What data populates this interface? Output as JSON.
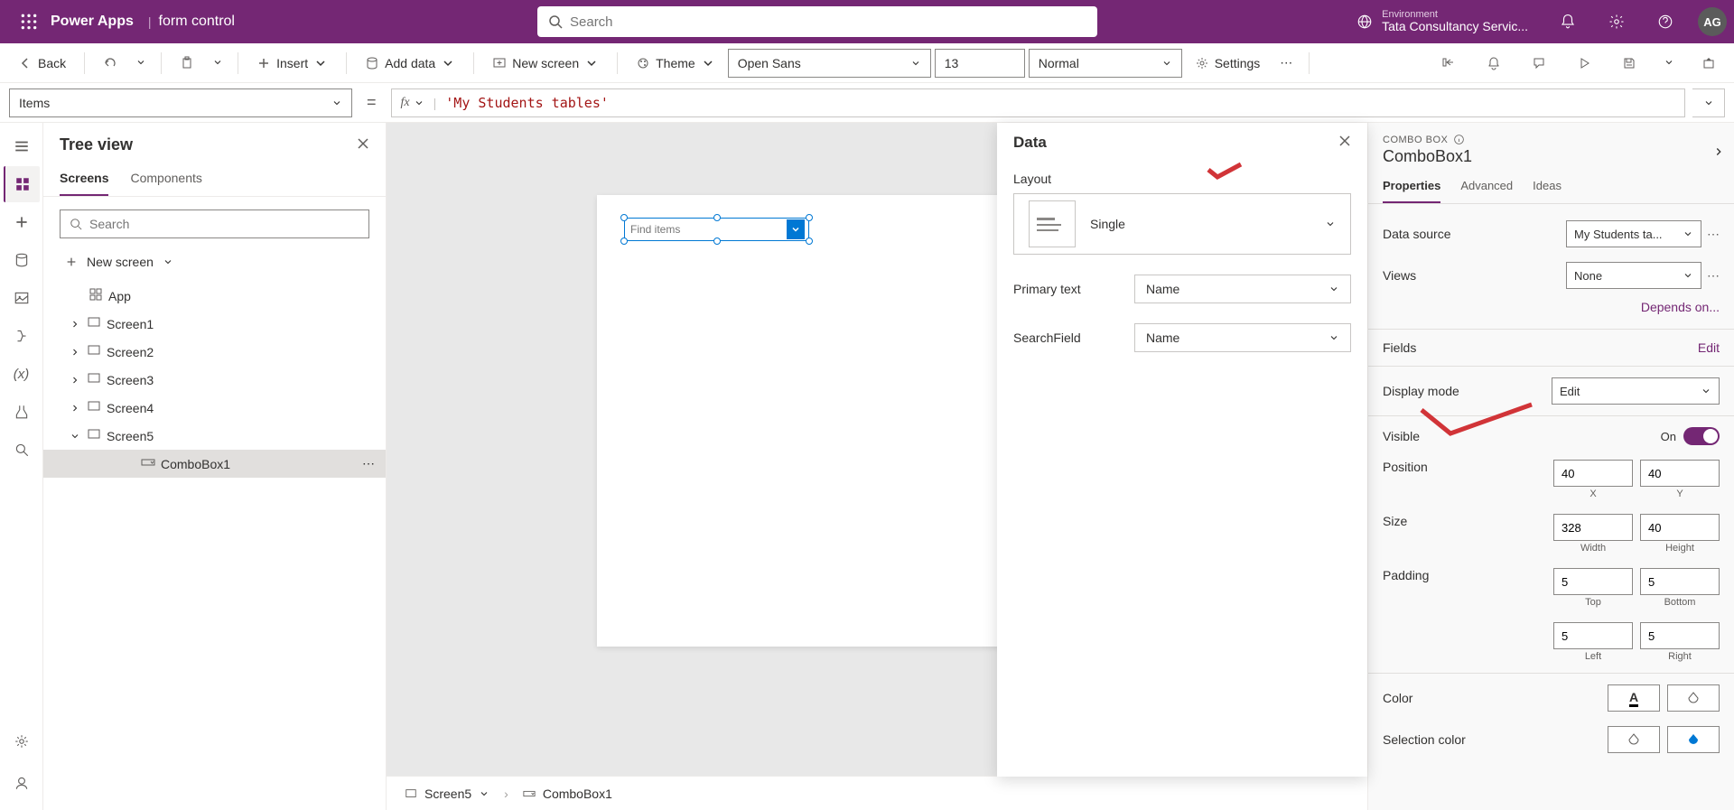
{
  "header": {
    "app": "Power Apps",
    "separator": "|",
    "doc": "form control",
    "search_placeholder": "Search",
    "env_label": "Environment",
    "env_name": "Tata Consultancy Servic...",
    "avatar": "AG"
  },
  "cmdbar": {
    "back": "Back",
    "insert": "Insert",
    "adddata": "Add data",
    "newscreen": "New screen",
    "theme": "Theme",
    "font_family": "Open Sans",
    "font_size": "13",
    "font_weight": "Normal",
    "settings": "Settings"
  },
  "formula": {
    "property": "Items",
    "fx": "fx",
    "value": "'My Students tables'"
  },
  "tree": {
    "title": "Tree view",
    "tabs": {
      "screens": "Screens",
      "components": "Components"
    },
    "search_placeholder": "Search",
    "newscreen": "New screen",
    "app": "App",
    "screens": [
      "Screen1",
      "Screen2",
      "Screen3",
      "Screen4",
      "Screen5"
    ],
    "combobox": "ComboBox1"
  },
  "canvas": {
    "combobox_placeholder": "Find items"
  },
  "breadcrumb": {
    "screen": "Screen5",
    "control": "ComboBox1"
  },
  "datapanel": {
    "title": "Data",
    "layout_label": "Layout",
    "layout_value": "Single",
    "primary_text_label": "Primary text",
    "primary_text_value": "Name",
    "searchfield_label": "SearchField",
    "searchfield_value": "Name"
  },
  "props": {
    "type": "COMBO BOX",
    "name": "ComboBox1",
    "tabs": {
      "properties": "Properties",
      "advanced": "Advanced",
      "ideas": "Ideas"
    },
    "datasource_label": "Data source",
    "datasource_value": "My Students ta...",
    "views_label": "Views",
    "views_value": "None",
    "depends": "Depends on...",
    "fields_label": "Fields",
    "fields_edit": "Edit",
    "displaymode_label": "Display mode",
    "displaymode_value": "Edit",
    "visible_label": "Visible",
    "visible_on": "On",
    "position_label": "Position",
    "pos_x": "40",
    "pos_y": "40",
    "x": "X",
    "y": "Y",
    "size_label": "Size",
    "width": "328",
    "height": "40",
    "w": "Width",
    "h": "Height",
    "padding_label": "Padding",
    "pad_top": "5",
    "pad_bottom": "5",
    "pad_left": "5",
    "pad_right": "5",
    "top": "Top",
    "bottom": "Bottom",
    "left": "Left",
    "right": "Right",
    "color_label": "Color",
    "selcolor_label": "Selection color"
  }
}
